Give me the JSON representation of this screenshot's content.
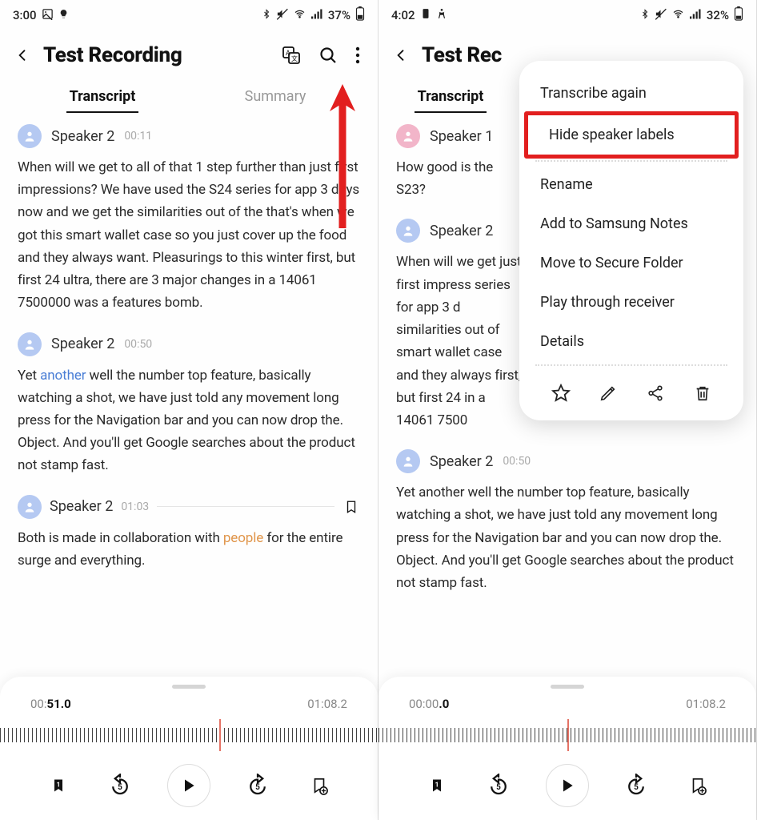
{
  "left": {
    "status": {
      "time": "3:00",
      "battery": "37%"
    },
    "title": "Test Recording",
    "tabs": {
      "transcript": "Transcript",
      "summary": "Summary"
    },
    "blocks": [
      {
        "speaker": "Speaker 2",
        "time": "00:11",
        "avatar": "blue",
        "text": "When will we get to all of that 1 step further than just first impressions? We have used the S24 series for app 3 days now and we get the similarities out of the that's when we got this smart wallet case so you just cover up the food and they always want. Pleasurings to this winter first, but first 24 ultra, there are 3 major changes in a 14061 7500000 was a features bomb."
      },
      {
        "speaker": "Speaker 2",
        "time": "00:50",
        "avatar": "blue",
        "text_pre": "Yet ",
        "hl_blue": "another",
        "text_post": " well the number top feature, basically watching a shot, we have just told any movement long press for the Navigation bar and you can now drop the. Object. And you'll get Google searches about the product not stamp fast."
      },
      {
        "speaker": "Speaker 2",
        "time": "01:03",
        "avatar": "blue",
        "text_pre": "Both is made in collaboration with ",
        "hl_orange": "people",
        "text_post": " for the entire surge and everything.",
        "has_bookmark": true
      }
    ],
    "player": {
      "current_pre": "00:",
      "current_bold": "51.0",
      "total": "01:08.2",
      "playhead_pct": 58
    }
  },
  "right": {
    "status": {
      "time": "4:02",
      "battery": "32%"
    },
    "title": "Test Rec",
    "tabs": {
      "transcript": "Transcript"
    },
    "blocks": [
      {
        "speaker": "Speaker 1",
        "time": "",
        "avatar": "pink",
        "text": "How good is the S23?"
      },
      {
        "speaker": "Speaker 2",
        "time": "",
        "avatar": "blue",
        "text": "When will we get just first impress series for app 3 d similarities out of smart wallet case and they always first, but first 24 in a 14061 7500",
        "clipped": true
      },
      {
        "speaker": "Speaker 2",
        "time": "00:50",
        "avatar": "blue",
        "text": "Yet another well the number top feature, basically watching a shot, we have just told any movement long press for the Navigation bar and you can now drop the. Object. And you'll get Google searches about the product not stamp fast."
      }
    ],
    "menu": {
      "items": [
        "Transcribe again",
        "Hide speaker labels",
        "Rename",
        "Add to Samsung Notes",
        "Move to Secure Folder",
        "Play through receiver",
        "Details"
      ],
      "highlighted_index": 1
    },
    "player": {
      "current_pre": "00:00",
      "current_bold": ".0",
      "total": "01:08.2",
      "playhead_pct": 50
    }
  }
}
